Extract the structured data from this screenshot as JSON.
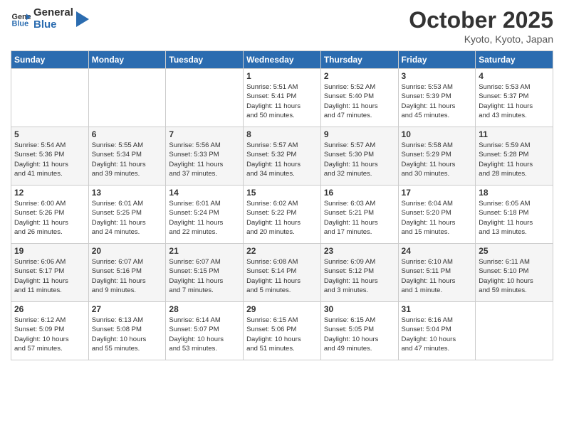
{
  "header": {
    "logo": "GeneralBlue",
    "month": "October 2025",
    "location": "Kyoto, Kyoto, Japan"
  },
  "weekdays": [
    "Sunday",
    "Monday",
    "Tuesday",
    "Wednesday",
    "Thursday",
    "Friday",
    "Saturday"
  ],
  "weeks": [
    [
      {
        "day": "",
        "info": ""
      },
      {
        "day": "",
        "info": ""
      },
      {
        "day": "",
        "info": ""
      },
      {
        "day": "1",
        "info": "Sunrise: 5:51 AM\nSunset: 5:41 PM\nDaylight: 11 hours\nand 50 minutes."
      },
      {
        "day": "2",
        "info": "Sunrise: 5:52 AM\nSunset: 5:40 PM\nDaylight: 11 hours\nand 47 minutes."
      },
      {
        "day": "3",
        "info": "Sunrise: 5:53 AM\nSunset: 5:39 PM\nDaylight: 11 hours\nand 45 minutes."
      },
      {
        "day": "4",
        "info": "Sunrise: 5:53 AM\nSunset: 5:37 PM\nDaylight: 11 hours\nand 43 minutes."
      }
    ],
    [
      {
        "day": "5",
        "info": "Sunrise: 5:54 AM\nSunset: 5:36 PM\nDaylight: 11 hours\nand 41 minutes."
      },
      {
        "day": "6",
        "info": "Sunrise: 5:55 AM\nSunset: 5:34 PM\nDaylight: 11 hours\nand 39 minutes."
      },
      {
        "day": "7",
        "info": "Sunrise: 5:56 AM\nSunset: 5:33 PM\nDaylight: 11 hours\nand 37 minutes."
      },
      {
        "day": "8",
        "info": "Sunrise: 5:57 AM\nSunset: 5:32 PM\nDaylight: 11 hours\nand 34 minutes."
      },
      {
        "day": "9",
        "info": "Sunrise: 5:57 AM\nSunset: 5:30 PM\nDaylight: 11 hours\nand 32 minutes."
      },
      {
        "day": "10",
        "info": "Sunrise: 5:58 AM\nSunset: 5:29 PM\nDaylight: 11 hours\nand 30 minutes."
      },
      {
        "day": "11",
        "info": "Sunrise: 5:59 AM\nSunset: 5:28 PM\nDaylight: 11 hours\nand 28 minutes."
      }
    ],
    [
      {
        "day": "12",
        "info": "Sunrise: 6:00 AM\nSunset: 5:26 PM\nDaylight: 11 hours\nand 26 minutes."
      },
      {
        "day": "13",
        "info": "Sunrise: 6:01 AM\nSunset: 5:25 PM\nDaylight: 11 hours\nand 24 minutes."
      },
      {
        "day": "14",
        "info": "Sunrise: 6:01 AM\nSunset: 5:24 PM\nDaylight: 11 hours\nand 22 minutes."
      },
      {
        "day": "15",
        "info": "Sunrise: 6:02 AM\nSunset: 5:22 PM\nDaylight: 11 hours\nand 20 minutes."
      },
      {
        "day": "16",
        "info": "Sunrise: 6:03 AM\nSunset: 5:21 PM\nDaylight: 11 hours\nand 17 minutes."
      },
      {
        "day": "17",
        "info": "Sunrise: 6:04 AM\nSunset: 5:20 PM\nDaylight: 11 hours\nand 15 minutes."
      },
      {
        "day": "18",
        "info": "Sunrise: 6:05 AM\nSunset: 5:18 PM\nDaylight: 11 hours\nand 13 minutes."
      }
    ],
    [
      {
        "day": "19",
        "info": "Sunrise: 6:06 AM\nSunset: 5:17 PM\nDaylight: 11 hours\nand 11 minutes."
      },
      {
        "day": "20",
        "info": "Sunrise: 6:07 AM\nSunset: 5:16 PM\nDaylight: 11 hours\nand 9 minutes."
      },
      {
        "day": "21",
        "info": "Sunrise: 6:07 AM\nSunset: 5:15 PM\nDaylight: 11 hours\nand 7 minutes."
      },
      {
        "day": "22",
        "info": "Sunrise: 6:08 AM\nSunset: 5:14 PM\nDaylight: 11 hours\nand 5 minutes."
      },
      {
        "day": "23",
        "info": "Sunrise: 6:09 AM\nSunset: 5:12 PM\nDaylight: 11 hours\nand 3 minutes."
      },
      {
        "day": "24",
        "info": "Sunrise: 6:10 AM\nSunset: 5:11 PM\nDaylight: 11 hours\nand 1 minute."
      },
      {
        "day": "25",
        "info": "Sunrise: 6:11 AM\nSunset: 5:10 PM\nDaylight: 10 hours\nand 59 minutes."
      }
    ],
    [
      {
        "day": "26",
        "info": "Sunrise: 6:12 AM\nSunset: 5:09 PM\nDaylight: 10 hours\nand 57 minutes."
      },
      {
        "day": "27",
        "info": "Sunrise: 6:13 AM\nSunset: 5:08 PM\nDaylight: 10 hours\nand 55 minutes."
      },
      {
        "day": "28",
        "info": "Sunrise: 6:14 AM\nSunset: 5:07 PM\nDaylight: 10 hours\nand 53 minutes."
      },
      {
        "day": "29",
        "info": "Sunrise: 6:15 AM\nSunset: 5:06 PM\nDaylight: 10 hours\nand 51 minutes."
      },
      {
        "day": "30",
        "info": "Sunrise: 6:15 AM\nSunset: 5:05 PM\nDaylight: 10 hours\nand 49 minutes."
      },
      {
        "day": "31",
        "info": "Sunrise: 6:16 AM\nSunset: 5:04 PM\nDaylight: 10 hours\nand 47 minutes."
      },
      {
        "day": "",
        "info": ""
      }
    ]
  ]
}
